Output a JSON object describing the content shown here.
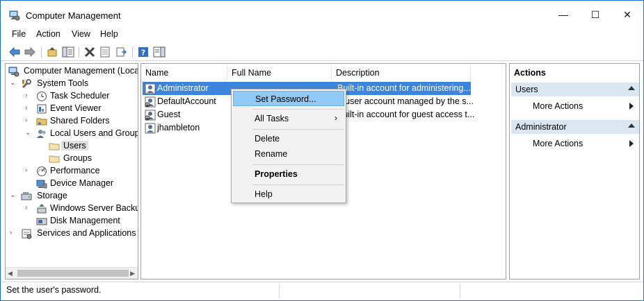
{
  "window": {
    "title": "Computer Management",
    "controls": {
      "minimize": "—",
      "maximize": "☐",
      "close": "✕"
    }
  },
  "menu": [
    "File",
    "Action",
    "View",
    "Help"
  ],
  "toolbar": {
    "icons": [
      "back-arrow-icon",
      "forward-arrow-icon",
      "up-folder-icon",
      "show-hide-tree-icon",
      "delete-icon",
      "properties-icon",
      "export-list-icon",
      "help-icon",
      "show-hide-action-pane-icon"
    ]
  },
  "tree": {
    "root": "Computer Management (Local",
    "system_tools": "System Tools",
    "task_scheduler": "Task Scheduler",
    "event_viewer": "Event Viewer",
    "shared_folders": "Shared Folders",
    "local_users_groups": "Local Users and Groups",
    "users": "Users",
    "groups": "Groups",
    "performance": "Performance",
    "device_manager": "Device Manager",
    "storage": "Storage",
    "windows_server_backup": "Windows Server Backup",
    "disk_management": "Disk Management",
    "services_apps": "Services and Applications"
  },
  "list": {
    "columns": [
      "Name",
      "Full Name",
      "Description"
    ],
    "rows": [
      {
        "name": "Administrator",
        "full_name": "",
        "description": "Built-in account for administering..."
      },
      {
        "name": "DefaultAccount",
        "full_name": "",
        "description": "A user account managed by the s..."
      },
      {
        "name": "Guest",
        "full_name": "",
        "description": "Built-in account for guest access t..."
      },
      {
        "name": "jhambleton",
        "full_name": "",
        "description": ""
      }
    ]
  },
  "context_menu": {
    "set_password": "Set Password...",
    "all_tasks": "All Tasks",
    "submenu_arrow": "›",
    "delete": "Delete",
    "rename": "Rename",
    "properties": "Properties",
    "help": "Help"
  },
  "actions": {
    "title": "Actions",
    "group1": "Users",
    "group1_more": "More Actions",
    "group2": "Administrator",
    "group2_more": "More Actions"
  },
  "status": "Set the user's password.",
  "colors": {
    "selection": "#3d85dc",
    "menu_hover": "#91c9f7",
    "actions_header": "#dbe6f3",
    "window_border": "#1a6fc9"
  }
}
